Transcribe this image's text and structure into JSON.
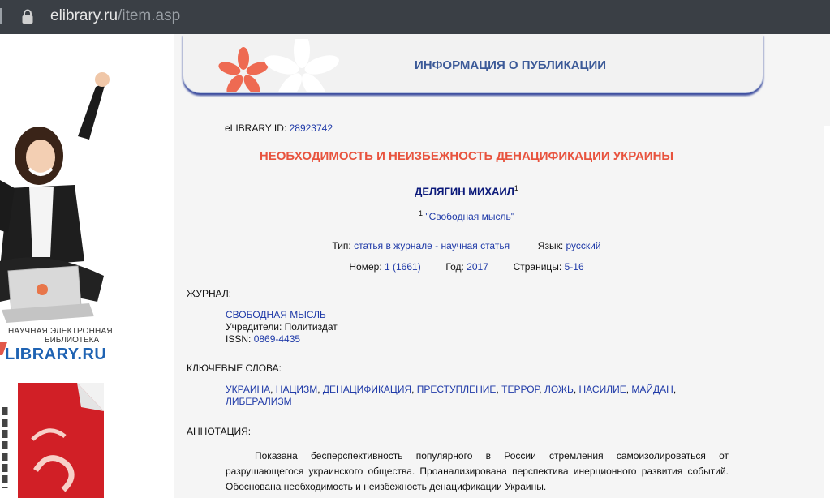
{
  "browser": {
    "url_domain": "elibrary.ru",
    "url_path": "/item.asp"
  },
  "sidebar": {
    "logo_line1": "НАУЧНАЯ ЭЛЕКТРОННАЯ",
    "logo_line2": "БИБЛИОТЕКА",
    "logo_brand": "LIBRARY.RU"
  },
  "banner": {
    "title": "ИНФОРМАЦИЯ О ПУБЛИКАЦИИ"
  },
  "publication": {
    "id_label": "eLIBRARY ID:",
    "id_value": "28923742",
    "title": "НЕОБХОДИМОСТЬ И НЕИЗБЕЖНОСТЬ ДЕНАЦИФИКАЦИИ УКРАИНЫ",
    "author": "ДЕЛЯГИН МИХАИЛ",
    "author_sup": "1",
    "affil_sup": "1",
    "affil_name": "\"Свободная мысль\"",
    "type_label": "Тип:",
    "type_value": "статья в журнале - научная статья",
    "lang_label": "Язык:",
    "lang_value": "русский",
    "number_label": "Номер:",
    "number_value": "1 (1661)",
    "year_label": "Год:",
    "year_value": "2017",
    "pages_label": "Страницы:",
    "pages_value": "5-16"
  },
  "journal": {
    "section_label": "ЖУРНАЛ:",
    "name": "СВОБОДНАЯ МЫСЛЬ",
    "founders": "Учредители: Политиздат",
    "issn_label": "ISSN:",
    "issn_value": "0869-4435"
  },
  "keywords": {
    "section_label": "КЛЮЧЕВЫЕ СЛОВА:",
    "items": [
      "УКРАИНА",
      "НАЦИЗМ",
      "ДЕНАЦИФИКАЦИЯ",
      "ПРЕСТУПЛЕНИЕ",
      "ТЕРРОР",
      "ЛОЖЬ",
      "НАСИЛИЕ",
      "МАЙДАН",
      "ЛИБЕРАЛИЗМ"
    ]
  },
  "annotation": {
    "section_label": "АННОТАЦИЯ:",
    "text": "Показана бесперспективность популярного в России стремления самоизолироваться от разрушающегося украинского общества. Проанализирована перспектива инерционного развития событий. Обоснована необходимость и неизбежность денацификации Украины."
  }
}
